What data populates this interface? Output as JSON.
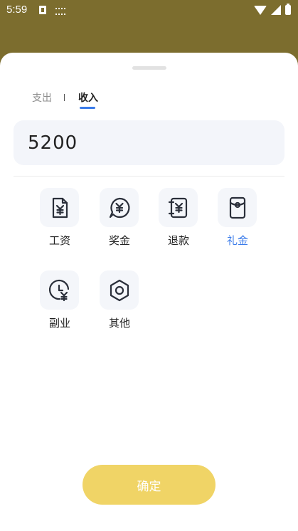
{
  "status_bar": {
    "time": "5:59"
  },
  "tabs": [
    {
      "label": "支出"
    },
    {
      "label": "收入"
    }
  ],
  "amount": {
    "value": "5200"
  },
  "categories": [
    {
      "label": "工资",
      "icon": "salary-icon"
    },
    {
      "label": "奖金",
      "icon": "bonus-icon"
    },
    {
      "label": "退款",
      "icon": "refund-icon"
    },
    {
      "label": "礼金",
      "icon": "gift-money-icon"
    },
    {
      "label": "副业",
      "icon": "side-job-icon"
    },
    {
      "label": "其他",
      "icon": "other-icon"
    }
  ],
  "confirm": {
    "label": "确定"
  },
  "colors": {
    "accent": "#3a7bea",
    "confirm": "#f0d466",
    "backdrop": "#7c6d2e"
  }
}
